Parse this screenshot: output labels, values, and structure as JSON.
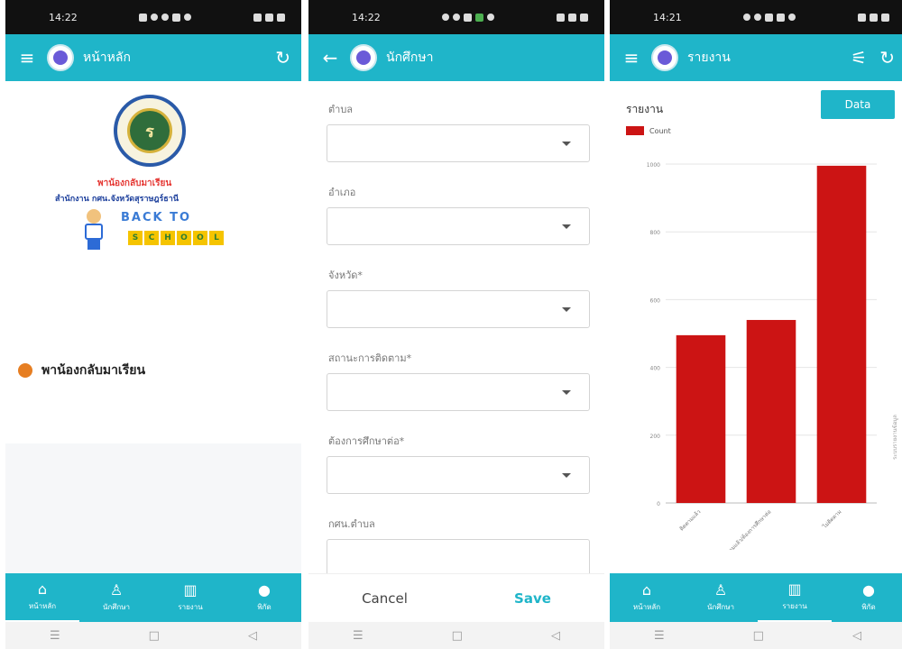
{
  "screens": [
    {
      "status": {
        "time": "14:22"
      },
      "appbar": {
        "title": "หน้าหลัก",
        "left_icon": "menu-icon",
        "right_icon": "refresh-icon"
      },
      "banner": {
        "line1": "พาน้องกลับมาเรียน",
        "line2": "สำนักงาน กศน.จังหวัดสุราษฎร์ธานี",
        "back_to": "BACK TO",
        "school_letters": [
          "S",
          "C",
          "H",
          "O",
          "O",
          "L"
        ]
      },
      "main_item": "พาน้องกลับมาเรียน"
    },
    {
      "status": {
        "time": "14:22"
      },
      "appbar": {
        "title": "นักศึกษา",
        "left_icon": "back-arrow-icon"
      },
      "form": {
        "fields": [
          {
            "label": "ตำบล",
            "value": ""
          },
          {
            "label": "อำเภอ",
            "value": ""
          },
          {
            "label": "จังหวัด*",
            "value": ""
          },
          {
            "label": "สถานะการติดตาม*",
            "value": ""
          },
          {
            "label": "ต้องการศึกษาต่อ*",
            "value": ""
          },
          {
            "label": "กศน.ตำบล",
            "value": ""
          }
        ],
        "cancel": "Cancel",
        "save": "Save"
      }
    },
    {
      "status": {
        "time": "14:21"
      },
      "appbar": {
        "title": "รายงาน",
        "left_icon": "menu-icon",
        "right_icons": [
          "filter-icon",
          "refresh-icon"
        ]
      },
      "report": {
        "title": "รายงาน",
        "data_button": "Data",
        "side_label": "ระบบรายงานข้อมูล"
      }
    }
  ],
  "bottom_nav": [
    {
      "label": "หน้าหลัก",
      "icon": "home-icon"
    },
    {
      "label": "นักศึกษา",
      "icon": "student-icon"
    },
    {
      "label": "รายงาน",
      "icon": "chart-icon"
    },
    {
      "label": "พิกัด",
      "icon": "location-icon"
    }
  ],
  "colors": {
    "primary": "#1fb5c9",
    "bar": "#cc1414",
    "accent": "#e67e22"
  },
  "chart_data": {
    "type": "bar",
    "categories": [
      "ติดตามแล้ว",
      "ติดตามแล้ว/ต้องการศึกษาต่อ",
      "ไม่ติดตาม"
    ],
    "series": [
      {
        "name": "Count",
        "values": [
          495,
          540,
          995
        ]
      }
    ],
    "ylim": [
      0,
      1000
    ],
    "yticks": [
      0,
      200,
      400,
      600,
      800,
      1000
    ],
    "legend": "top-left",
    "grid": true
  }
}
